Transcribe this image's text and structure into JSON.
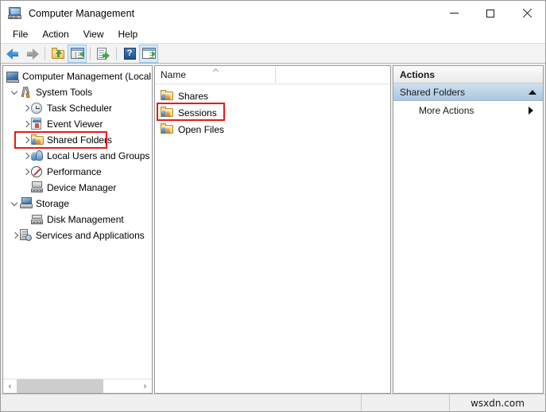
{
  "window": {
    "title": "Computer Management",
    "icon": "computer-management-icon",
    "controls": {
      "minimize": "minimize",
      "maximize": "maximize",
      "close": "close"
    }
  },
  "menubar": {
    "items": [
      {
        "label": "File"
      },
      {
        "label": "Action"
      },
      {
        "label": "View"
      },
      {
        "label": "Help"
      }
    ]
  },
  "toolbar": {
    "buttons": [
      {
        "name": "back-button",
        "icon": "back-arrow-icon",
        "active": false
      },
      {
        "name": "forward-button",
        "icon": "forward-arrow-icon",
        "active": false
      },
      {
        "name": "up-one-level-button",
        "icon": "folder-up-icon",
        "active": false
      },
      {
        "name": "show-hide-console-tree-button",
        "icon": "console-tree-icon",
        "active": true
      },
      {
        "name": "export-list-button",
        "icon": "export-list-icon",
        "active": false
      },
      {
        "name": "help-button",
        "icon": "help-question-icon",
        "label": "?",
        "active": false
      },
      {
        "name": "show-hide-action-pane-button",
        "icon": "action-pane-icon",
        "active": true
      }
    ]
  },
  "tree": {
    "nodes": [
      {
        "label": "Computer Management (Local",
        "icon": "computer-icon",
        "indent": 0,
        "expander": "none",
        "highlighted": false
      },
      {
        "label": "System Tools",
        "icon": "system-tools-icon",
        "indent": 1,
        "expander": "down",
        "highlighted": false
      },
      {
        "label": "Task Scheduler",
        "icon": "clock-icon",
        "indent": 2,
        "expander": "right",
        "highlighted": false
      },
      {
        "label": "Event Viewer",
        "icon": "event-log-icon",
        "indent": 2,
        "expander": "right",
        "highlighted": false
      },
      {
        "label": "Shared Folders",
        "icon": "shared-folder-icon",
        "indent": 2,
        "expander": "right",
        "highlighted": true
      },
      {
        "label": "Local Users and Groups",
        "icon": "users-group-icon",
        "indent": 2,
        "expander": "right",
        "highlighted": false
      },
      {
        "label": "Performance",
        "icon": "performance-icon",
        "indent": 2,
        "expander": "right",
        "highlighted": false
      },
      {
        "label": "Device Manager",
        "icon": "device-manager-icon",
        "indent": 2,
        "expander": "none",
        "highlighted": false
      },
      {
        "label": "Storage",
        "icon": "storage-icon",
        "indent": 1,
        "expander": "down",
        "highlighted": false
      },
      {
        "label": "Disk Management",
        "icon": "disk-management-icon",
        "indent": 2,
        "expander": "none",
        "highlighted": false
      },
      {
        "label": "Services and Applications",
        "icon": "services-icon",
        "indent": 1,
        "expander": "right",
        "highlighted": false
      }
    ],
    "scrollbar": {
      "left_arrow": "‹",
      "right_arrow": "›"
    }
  },
  "list": {
    "columns": [
      {
        "label": "Name",
        "sort": "ascending"
      }
    ],
    "rows": [
      {
        "label": "Shares",
        "icon": "shared-folder-icon",
        "highlighted": false
      },
      {
        "label": "Sessions",
        "icon": "shared-folder-icon",
        "highlighted": true
      },
      {
        "label": "Open Files",
        "icon": "shared-folder-icon",
        "highlighted": false
      }
    ]
  },
  "actions": {
    "title": "Actions",
    "group": {
      "label": "Shared Folders",
      "collapse_icon": "chevron-up-icon"
    },
    "items": [
      {
        "label": "More Actions",
        "submenu_icon": "chevron-right-icon"
      }
    ]
  },
  "statusbar": {
    "left": "",
    "middle": "",
    "watermark": "wsxdn.com"
  },
  "colors": {
    "highlight_red": "#e8191a",
    "actions_group_blue": "#a9c7e0",
    "window_bg": "#f0f0f0"
  }
}
